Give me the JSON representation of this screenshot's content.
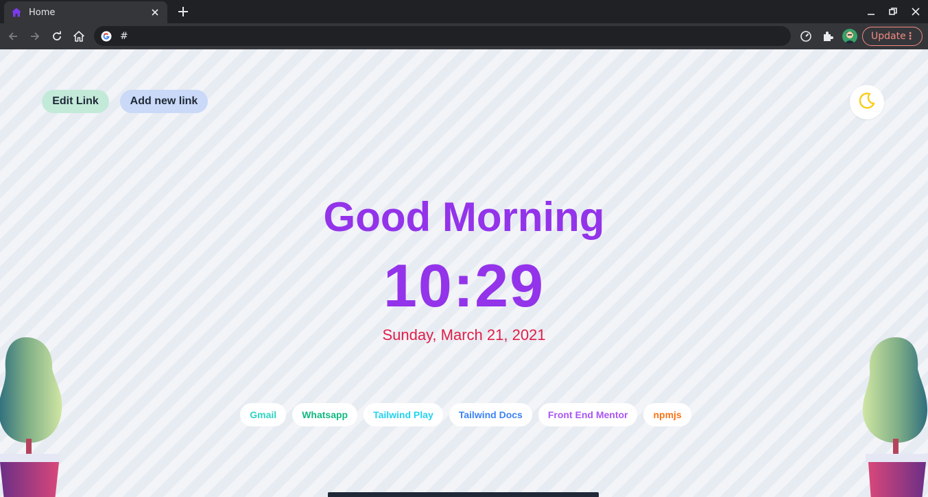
{
  "browser": {
    "tab_title": "Home",
    "tab_favicon": "home-icon",
    "address": "#",
    "update_label": "Update",
    "colors": {
      "tab_bg": "#35363a",
      "frame_bg": "#202124",
      "update_accent": "#f28b82"
    }
  },
  "header": {
    "edit_link_label": "Edit Link",
    "add_link_label": "Add new link",
    "theme_toggle_icon": "moon-icon"
  },
  "hero": {
    "greeting": "Good Morning",
    "time": "10:29",
    "date": "Sunday, March 21, 2021"
  },
  "links": [
    {
      "label": "Gmail",
      "color": "#2dd4bf"
    },
    {
      "label": "Whatsapp",
      "color": "#10b981"
    },
    {
      "label": "Tailwind Play",
      "color": "#22d3ee"
    },
    {
      "label": "Tailwind Docs",
      "color": "#3b82f6"
    },
    {
      "label": "Front End Mentor",
      "color": "#a855f7"
    },
    {
      "label": "npmjs",
      "color": "#f97316"
    }
  ],
  "colors": {
    "accent": "#9333ea",
    "date": "#e11d48",
    "edit_btn_bg": "#c3ead9",
    "add_btn_bg": "#c9d9f7"
  }
}
